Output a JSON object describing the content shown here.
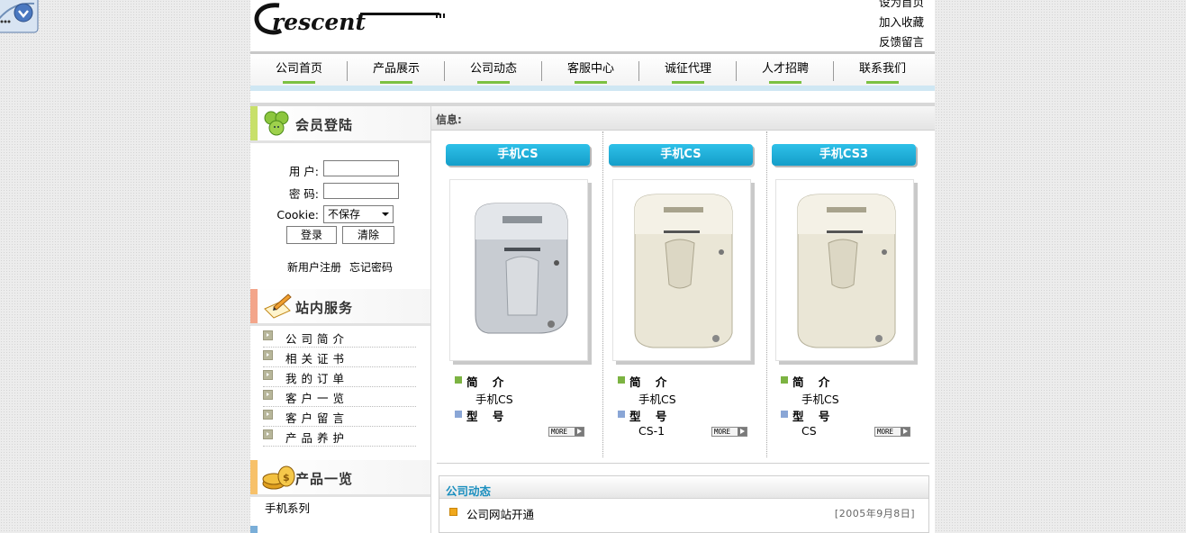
{
  "header": {
    "logo_text": "rescent",
    "top_links": [
      "设为首页",
      "加入收藏",
      "反馈留言"
    ]
  },
  "nav": {
    "items": [
      "公司首页",
      "产品展示",
      "公司动态",
      "客服中心",
      "诚征代理",
      "人才招聘",
      "联系我们"
    ],
    "accent_color": "#7cc142"
  },
  "login": {
    "title": "会员登陆",
    "user_label": "用 户:",
    "password_label": "密 码:",
    "cookie_label": "Cookie:",
    "user_value": "",
    "password_value": "",
    "cookie_selected": "不保存",
    "login_button": "登录",
    "clear_button": "清除",
    "register_link": "新用户注册",
    "forgot_link": "忘记密码"
  },
  "services": {
    "title": "站内服务",
    "items": [
      "公司简介",
      "相关证书",
      "我的订单",
      "客户一览",
      "客户留言",
      "产品养护"
    ]
  },
  "products_box": {
    "title": "产品一览",
    "items": [
      "手机系列"
    ]
  },
  "main": {
    "info_label": "信息:",
    "products": [
      {
        "name": "手机CS",
        "intro_label": "简 介",
        "intro_value": "手机CS",
        "model_label": "型 号",
        "model_value": "",
        "more": "MORE"
      },
      {
        "name": "手机CS",
        "intro_label": "简 介",
        "intro_value": "手机CS",
        "model_label": "型 号",
        "model_value": "CS-1",
        "more": "MORE"
      },
      {
        "name": "手机CS3",
        "intro_label": "简 介",
        "intro_value": "手机CS",
        "model_label": "型 号",
        "model_value": "CS",
        "more": "MORE"
      }
    ]
  },
  "news": {
    "title": "公司动态",
    "items": [
      {
        "title": "公司网站开通",
        "date": "[2005年9月8日]"
      }
    ]
  },
  "colors": {
    "pill": "#1aa9d6",
    "news_title": "#1b8fbf"
  }
}
